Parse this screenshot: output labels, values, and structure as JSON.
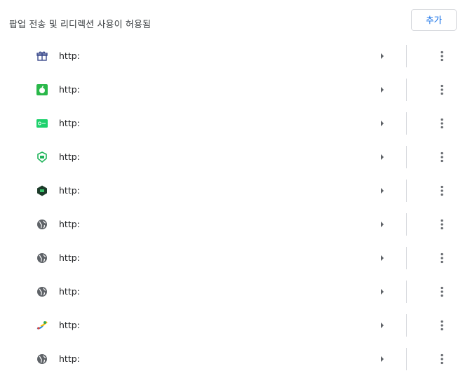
{
  "section": {
    "title": "팝업 전송 및 리디렉션 사용이 허용됨",
    "add_label": "추가"
  },
  "sites": [
    {
      "url": "http:",
      "icon": "gift-box-icon"
    },
    {
      "url": "http:",
      "icon": "green-apple-logo-icon"
    },
    {
      "url": "http:",
      "icon": "green-ticket-logo-icon"
    },
    {
      "url": "http:",
      "icon": "green-shield-logo-icon"
    },
    {
      "url": "http:",
      "icon": "dark-hexagon-logo-icon"
    },
    {
      "url": "http:",
      "icon": "globe-icon"
    },
    {
      "url": "http:",
      "icon": "globe-icon"
    },
    {
      "url": "http:",
      "icon": "globe-icon"
    },
    {
      "url": "http:",
      "icon": "colorful-swoosh-logo-icon"
    },
    {
      "url": "http:",
      "icon": "globe-icon"
    }
  ],
  "colors": {
    "accent": "#1a73e8",
    "divider": "#dadce0",
    "icon_gray": "#5f6368"
  }
}
